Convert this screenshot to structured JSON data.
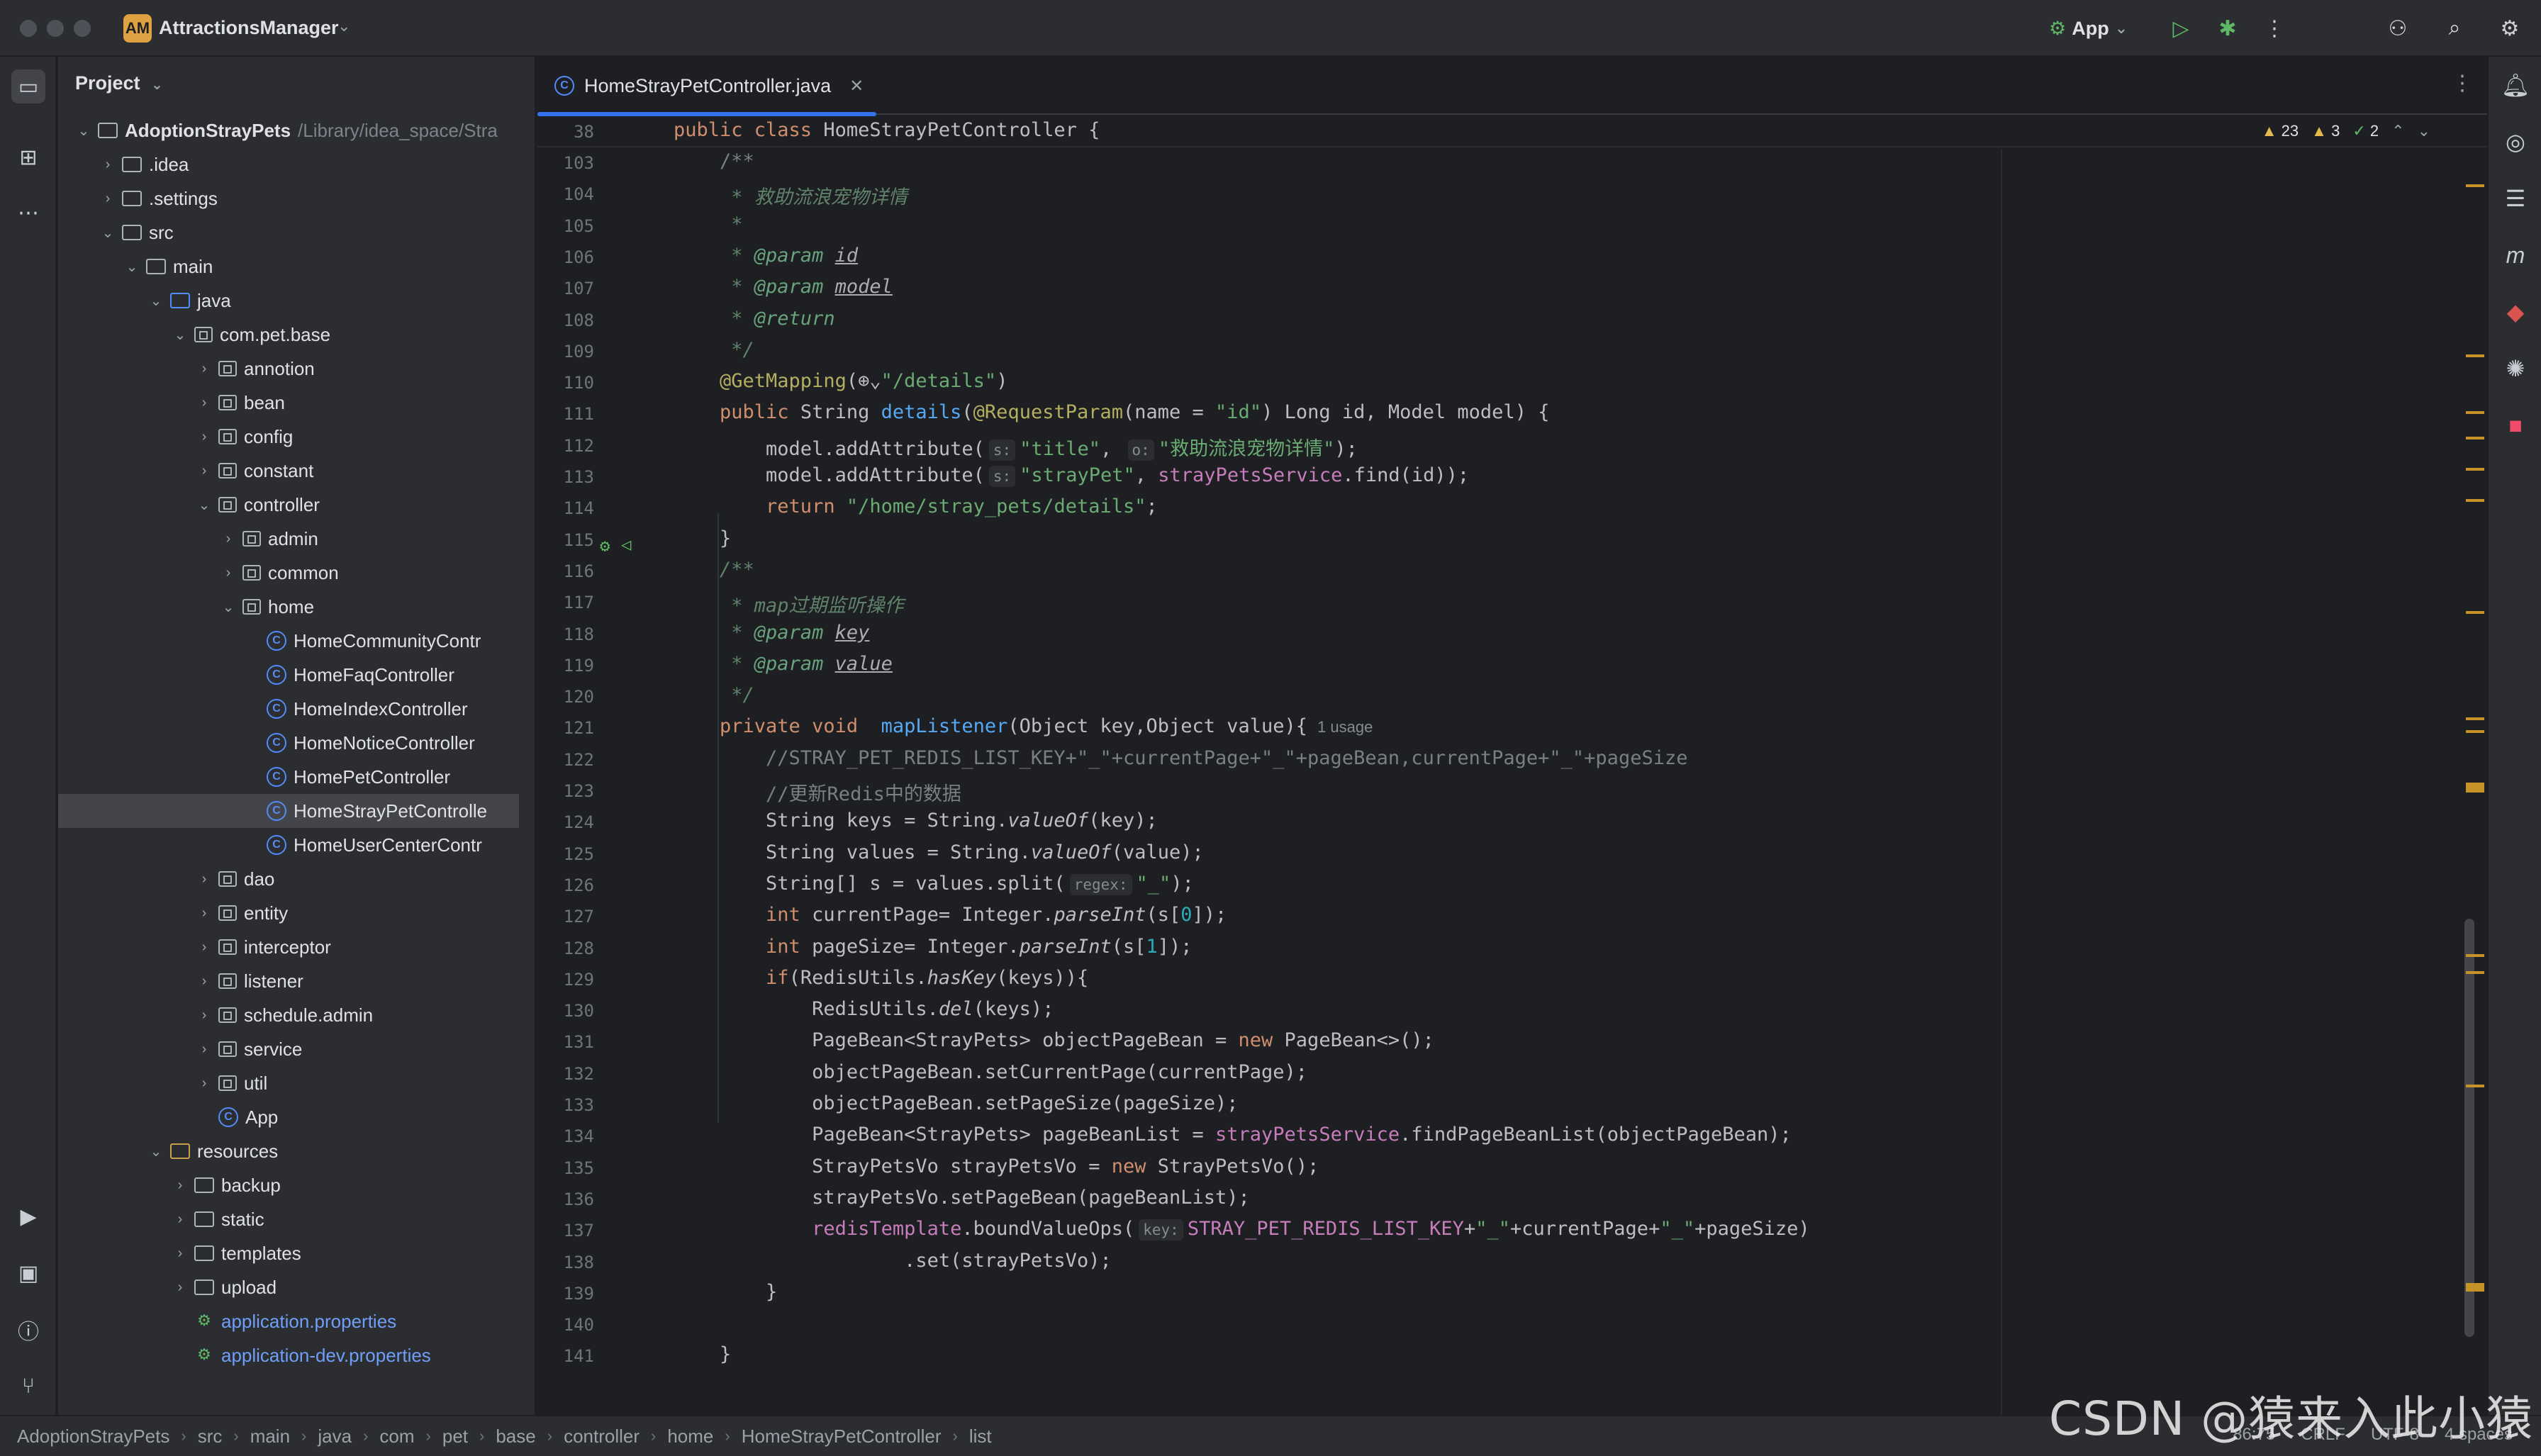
{
  "window": {
    "app_badge": "AM",
    "app_name": "AttractionsManager"
  },
  "toolbar": {
    "run_config": "App"
  },
  "project_panel": {
    "title": "Project",
    "tree": [
      {
        "label": "AdoptionStrayPets",
        "hint": "/Library/idea_space/Stra",
        "depth": 0,
        "type": "module",
        "arrow": "open",
        "bold": true
      },
      {
        "label": ".idea",
        "depth": 1,
        "type": "folder",
        "arrow": "closed"
      },
      {
        "label": ".settings",
        "depth": 1,
        "type": "folder",
        "arrow": "closed"
      },
      {
        "label": "src",
        "depth": 1,
        "type": "folder",
        "arrow": "open"
      },
      {
        "label": "main",
        "depth": 2,
        "type": "folder",
        "arrow": "open"
      },
      {
        "label": "java",
        "depth": 3,
        "type": "folder-blue",
        "arrow": "open"
      },
      {
        "label": "com.pet.base",
        "depth": 4,
        "type": "package",
        "arrow": "open"
      },
      {
        "label": "annotion",
        "depth": 5,
        "type": "package",
        "arrow": "closed"
      },
      {
        "label": "bean",
        "depth": 5,
        "type": "package",
        "arrow": "closed"
      },
      {
        "label": "config",
        "depth": 5,
        "type": "package",
        "arrow": "closed"
      },
      {
        "label": "constant",
        "depth": 5,
        "type": "package",
        "arrow": "closed"
      },
      {
        "label": "controller",
        "depth": 5,
        "type": "package",
        "arrow": "open"
      },
      {
        "label": "admin",
        "depth": 6,
        "type": "package",
        "arrow": "closed"
      },
      {
        "label": "common",
        "depth": 6,
        "type": "package",
        "arrow": "closed"
      },
      {
        "label": "home",
        "depth": 6,
        "type": "package",
        "arrow": "open"
      },
      {
        "label": "HomeCommunityContr",
        "depth": 7,
        "type": "class"
      },
      {
        "label": "HomeFaqController",
        "depth": 7,
        "type": "class"
      },
      {
        "label": "HomeIndexController",
        "depth": 7,
        "type": "class"
      },
      {
        "label": "HomeNoticeController",
        "depth": 7,
        "type": "class"
      },
      {
        "label": "HomePetController",
        "depth": 7,
        "type": "class"
      },
      {
        "label": "HomeStrayPetControlle",
        "depth": 7,
        "type": "class",
        "selected": true
      },
      {
        "label": "HomeUserCenterContr",
        "depth": 7,
        "type": "class"
      },
      {
        "label": "dao",
        "depth": 5,
        "type": "package",
        "arrow": "closed"
      },
      {
        "label": "entity",
        "depth": 5,
        "type": "package",
        "arrow": "closed"
      },
      {
        "label": "interceptor",
        "depth": 5,
        "type": "package",
        "arrow": "closed"
      },
      {
        "label": "listener",
        "depth": 5,
        "type": "package",
        "arrow": "closed"
      },
      {
        "label": "schedule.admin",
        "depth": 5,
        "type": "package",
        "arrow": "closed"
      },
      {
        "label": "service",
        "depth": 5,
        "type": "package",
        "arrow": "closed"
      },
      {
        "label": "util",
        "depth": 5,
        "type": "package",
        "arrow": "closed"
      },
      {
        "label": "App",
        "depth": 5,
        "type": "class-app"
      },
      {
        "label": "resources",
        "depth": 3,
        "type": "folder-res",
        "arrow": "open"
      },
      {
        "label": "backup",
        "depth": 4,
        "type": "folder",
        "arrow": "closed"
      },
      {
        "label": "static",
        "depth": 4,
        "type": "folder",
        "arrow": "closed"
      },
      {
        "label": "templates",
        "depth": 4,
        "type": "folder",
        "arrow": "closed"
      },
      {
        "label": "upload",
        "depth": 4,
        "type": "folder",
        "arrow": "closed"
      },
      {
        "label": "application.properties",
        "depth": 4,
        "type": "props",
        "blue": true
      },
      {
        "label": "application-dev.properties",
        "depth": 4,
        "type": "props",
        "blue": true
      }
    ]
  },
  "editor": {
    "tab_label": "HomeStrayPetController.java",
    "inspections": {
      "warnings_a": "23",
      "warnings_b": "3",
      "ok": "2"
    },
    "sticky": {
      "line": "38",
      "tokens": [
        [
          "kw",
          "public class "
        ],
        [
          "",
          "HomeStrayPetController {"
        ]
      ]
    },
    "lines": [
      {
        "n": "103",
        "tokens": [
          [
            "cm",
            "    /**"
          ]
        ]
      },
      {
        "n": "104",
        "tokens": [
          [
            "doc",
            "     * 救助流浪宠物详情"
          ]
        ]
      },
      {
        "n": "105",
        "tokens": [
          [
            "doc",
            "     *"
          ]
        ]
      },
      {
        "n": "106",
        "tokens": [
          [
            "doc",
            "     * "
          ],
          [
            "dtag",
            "@param "
          ],
          [
            "dparam",
            "id"
          ]
        ]
      },
      {
        "n": "107",
        "tokens": [
          [
            "doc",
            "     * "
          ],
          [
            "dtag",
            "@param "
          ],
          [
            "dparam",
            "model"
          ]
        ]
      },
      {
        "n": "108",
        "tokens": [
          [
            "doc",
            "     * "
          ],
          [
            "dtag",
            "@return"
          ]
        ]
      },
      {
        "n": "109",
        "tokens": [
          [
            "doc",
            "     */"
          ]
        ]
      },
      {
        "n": "110",
        "tokens": [
          [
            "ann",
            "    @GetMapping"
          ],
          [
            "",
            "(⊕⌄"
          ],
          [
            "str",
            "\"/details\""
          ],
          [
            "",
            ")"
          ]
        ]
      },
      {
        "n": "111",
        "tokens": [
          [
            "kw",
            "    public "
          ],
          [
            "",
            "String "
          ],
          [
            "fn",
            "details"
          ],
          [
            "",
            "("
          ],
          [
            "ann",
            "@RequestParam"
          ],
          [
            "",
            "(name = "
          ],
          [
            "str",
            "\"id\""
          ],
          [
            "",
            ") Long id, Model model) {"
          ]
        ]
      },
      {
        "n": "112",
        "tokens": [
          [
            "",
            "        model.addAttribute("
          ],
          [
            "hint",
            "s:"
          ],
          [
            "str",
            "\"title\""
          ],
          [
            "",
            ", "
          ],
          [
            "hint",
            "o:"
          ],
          [
            "str",
            "\"救助流浪宠物详情\""
          ],
          [
            "",
            ");"
          ]
        ]
      },
      {
        "n": "113",
        "tokens": [
          [
            "",
            "        model.addAttribute("
          ],
          [
            "hint",
            "s:"
          ],
          [
            "str",
            "\"strayPet\""
          ],
          [
            "",
            ", "
          ],
          [
            "fld",
            "strayPetsService"
          ],
          [
            "",
            ".find(id));"
          ]
        ]
      },
      {
        "n": "114",
        "tokens": [
          [
            "kw",
            "        return "
          ],
          [
            "str",
            "\"/home/stray_pets/details\""
          ],
          [
            "",
            ";"
          ]
        ]
      },
      {
        "n": "115",
        "tokens": [
          [
            "",
            "    }"
          ]
        ]
      },
      {
        "n": "116",
        "tokens": [
          [
            "doc",
            "    /**"
          ]
        ]
      },
      {
        "n": "117",
        "tokens": [
          [
            "doc",
            "     * map过期监听操作"
          ]
        ]
      },
      {
        "n": "118",
        "tokens": [
          [
            "doc",
            "     * "
          ],
          [
            "dtag",
            "@param "
          ],
          [
            "dparam",
            "key"
          ]
        ]
      },
      {
        "n": "119",
        "tokens": [
          [
            "doc",
            "     * "
          ],
          [
            "dtag",
            "@param "
          ],
          [
            "dparam",
            "value"
          ]
        ]
      },
      {
        "n": "120",
        "tokens": [
          [
            "doc",
            "     */"
          ]
        ]
      },
      {
        "n": "121",
        "tokens": [
          [
            "kw",
            "    private void  "
          ],
          [
            "fn",
            "mapListener"
          ],
          [
            "",
            "(Object key,Object value){"
          ],
          [
            "usage",
            "1 usage"
          ]
        ]
      },
      {
        "n": "122",
        "tokens": [
          [
            "cm",
            "        //STRAY_PET_REDIS_LIST_KEY+\"_\"+currentPage+\"_\"+pageBean,currentPage+\"_\"+pageSize"
          ]
        ]
      },
      {
        "n": "123",
        "tokens": [
          [
            "cm",
            "        //更新Redis中的数据"
          ]
        ]
      },
      {
        "n": "124",
        "tokens": [
          [
            "",
            "        String keys = String."
          ],
          [
            "ital",
            "valueOf"
          ],
          [
            "",
            "(key);"
          ]
        ]
      },
      {
        "n": "125",
        "tokens": [
          [
            "",
            "        String values = String."
          ],
          [
            "ital",
            "valueOf"
          ],
          [
            "",
            "(value);"
          ]
        ]
      },
      {
        "n": "126",
        "tokens": [
          [
            "",
            "        String[] s = values.split("
          ],
          [
            "hint",
            "regex:"
          ],
          [
            "str",
            "\"_\""
          ],
          [
            "",
            ");"
          ]
        ]
      },
      {
        "n": "127",
        "tokens": [
          [
            "kw",
            "        int "
          ],
          [
            "",
            "currentPage= Integer."
          ],
          [
            "ital",
            "parseInt"
          ],
          [
            "",
            "(s["
          ],
          [
            "num",
            "0"
          ],
          [
            "",
            "]);"
          ]
        ]
      },
      {
        "n": "128",
        "tokens": [
          [
            "kw",
            "        int "
          ],
          [
            "",
            "pageSize= Integer."
          ],
          [
            "ital",
            "parseInt"
          ],
          [
            "",
            "(s["
          ],
          [
            "num",
            "1"
          ],
          [
            "",
            "]);"
          ]
        ]
      },
      {
        "n": "129",
        "tokens": [
          [
            "kw",
            "        if"
          ],
          [
            "",
            "(RedisUtils."
          ],
          [
            "ital",
            "hasKey"
          ],
          [
            "",
            "(keys)){"
          ]
        ]
      },
      {
        "n": "130",
        "tokens": [
          [
            "",
            "            RedisUtils."
          ],
          [
            "ital",
            "del"
          ],
          [
            "",
            "(keys);"
          ]
        ]
      },
      {
        "n": "131",
        "tokens": [
          [
            "",
            "            PageBean<StrayPets> objectPageBean = "
          ],
          [
            "kw",
            "new "
          ],
          [
            "",
            "PageBean<>();"
          ]
        ]
      },
      {
        "n": "132",
        "tokens": [
          [
            "",
            "            objectPageBean.setCurrentPage(currentPage);"
          ]
        ]
      },
      {
        "n": "133",
        "tokens": [
          [
            "",
            "            objectPageBean.setPageSize(pageSize);"
          ]
        ]
      },
      {
        "n": "134",
        "tokens": [
          [
            "",
            "            PageBean<StrayPets> pageBeanList = "
          ],
          [
            "fld",
            "strayPetsService"
          ],
          [
            "",
            ".findPageBeanList(objectPageBean);"
          ]
        ]
      },
      {
        "n": "135",
        "tokens": [
          [
            "",
            "            StrayPetsVo strayPetsVo = "
          ],
          [
            "kw",
            "new "
          ],
          [
            "",
            "StrayPetsVo();"
          ]
        ]
      },
      {
        "n": "136",
        "tokens": [
          [
            "",
            "            strayPetsVo.setPageBean(pageBeanList);"
          ]
        ]
      },
      {
        "n": "137",
        "tokens": [
          [
            "fld",
            "            redisTemplate"
          ],
          [
            "",
            ".boundValueOps("
          ],
          [
            "hint",
            "key:"
          ],
          [
            "fld",
            "STRAY_PET_REDIS_LIST_KEY"
          ],
          [
            "",
            "+"
          ],
          [
            "str",
            "\"_\""
          ],
          [
            "",
            "+currentPage+"
          ],
          [
            "str",
            "\"_\""
          ],
          [
            "",
            "+pageSize)"
          ]
        ]
      },
      {
        "n": "138",
        "tokens": [
          [
            "",
            "                    .set(strayPetsVo);"
          ]
        ]
      },
      {
        "n": "139",
        "tokens": [
          [
            "",
            "        }"
          ]
        ]
      },
      {
        "n": "140",
        "tokens": [
          [
            "",
            ""
          ]
        ]
      },
      {
        "n": "141",
        "tokens": [
          [
            "",
            "    }"
          ]
        ]
      }
    ]
  },
  "statusbar": {
    "breadcrumbs": [
      "AdoptionStrayPets",
      "src",
      "main",
      "java",
      "com",
      "pet",
      "base",
      "controller",
      "home",
      "HomeStrayPetController",
      "list"
    ],
    "position": "86:75",
    "line_sep": "CRLF",
    "encoding": "UTF-8",
    "indent": "4 spaces"
  },
  "watermark": "CSDN @猿来入此小猿"
}
